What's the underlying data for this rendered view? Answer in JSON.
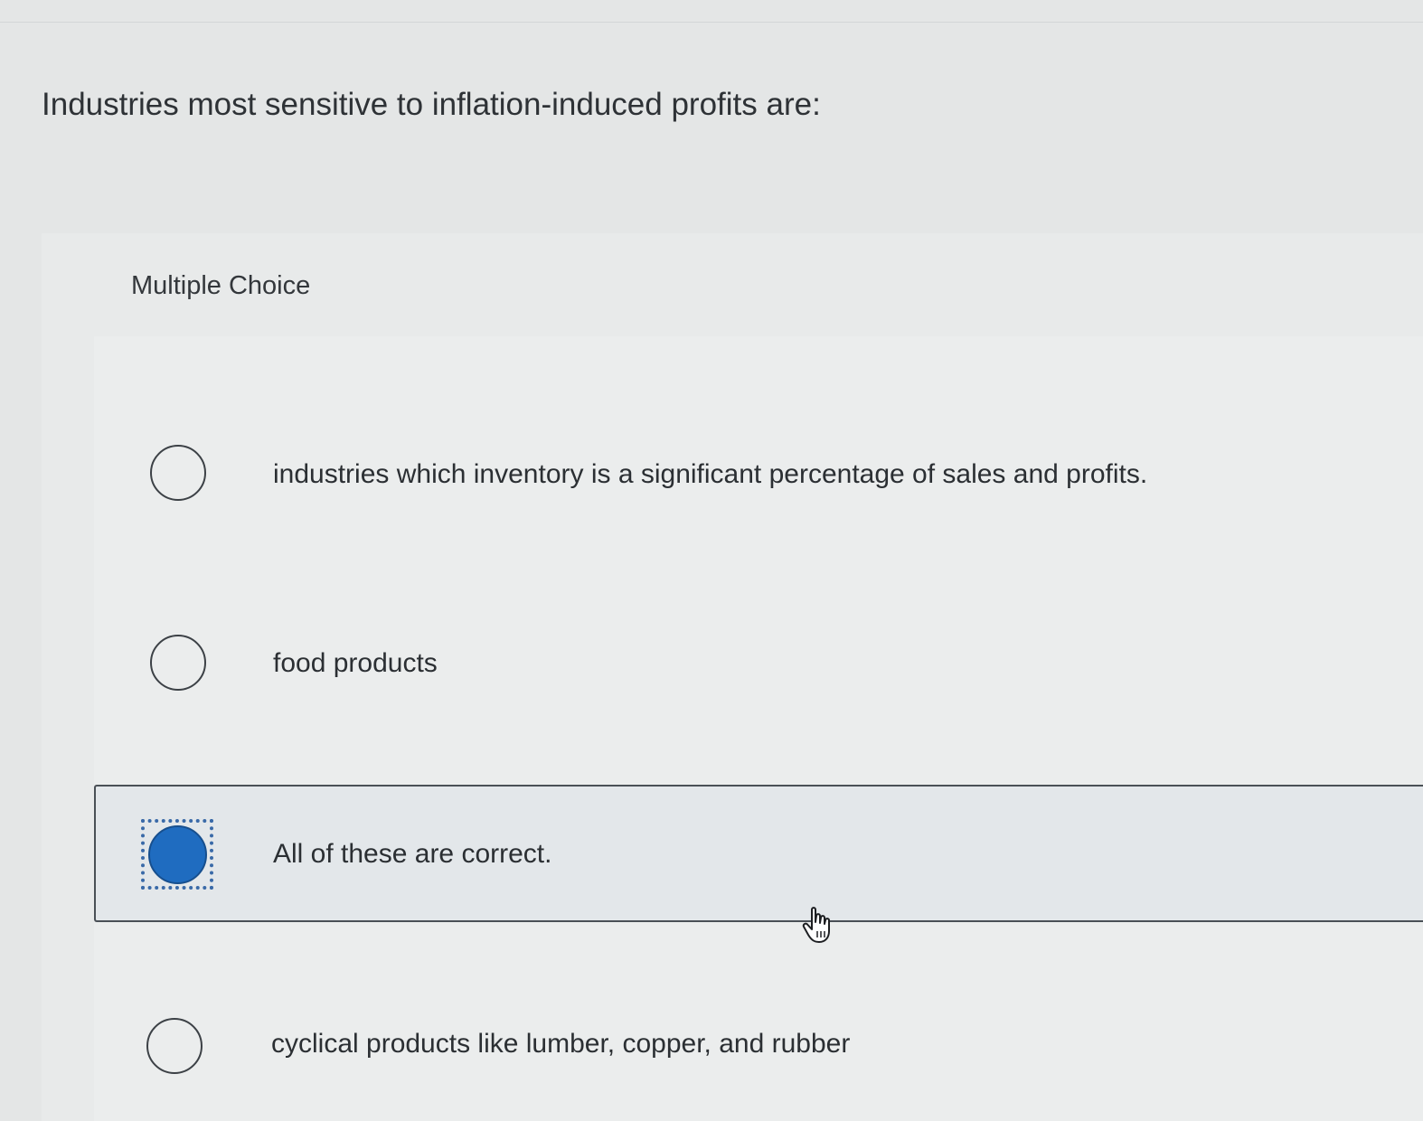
{
  "question": {
    "text": "Industries most sensitive to inflation-induced profits are:"
  },
  "section_label": "Multiple Choice",
  "options": [
    {
      "label": "industries which inventory is a significant percentage of sales and profits.",
      "selected": false
    },
    {
      "label": "food products",
      "selected": false
    },
    {
      "label": "All of these are correct.",
      "selected": true
    },
    {
      "label": "cyclical products like lumber, copper, and rubber",
      "selected": false
    }
  ],
  "colors": {
    "selected_radio": "#1f6cc0",
    "focus_ring": "#3a6aa8",
    "page_background": "#e4e6e6"
  },
  "icons": {
    "cursor": "hand-pointer-icon"
  }
}
